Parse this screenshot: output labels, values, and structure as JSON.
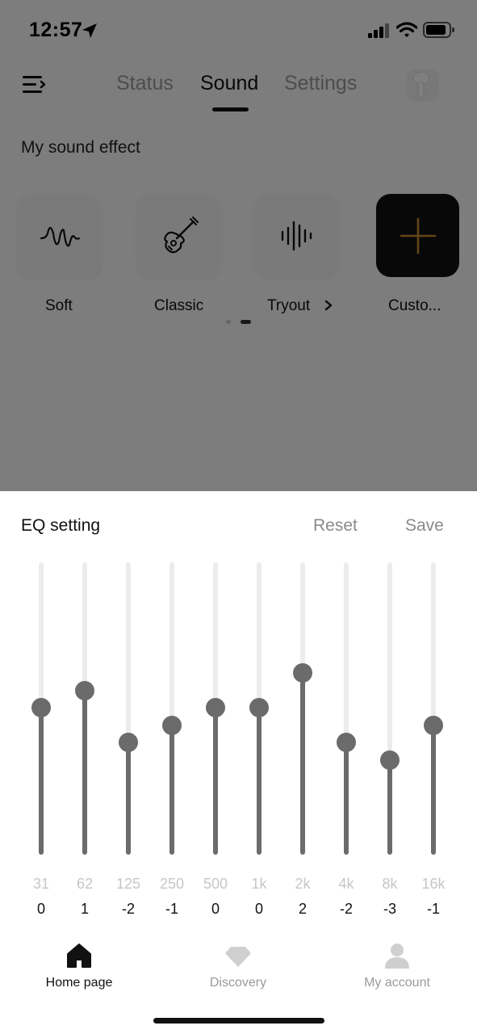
{
  "status_bar": {
    "time": "12:57"
  },
  "header": {
    "tabs": [
      {
        "label": "Status"
      },
      {
        "label": "Sound",
        "active": true
      },
      {
        "label": "Settings"
      }
    ]
  },
  "sound_effects": {
    "title": "My sound effect",
    "items": [
      {
        "label": "Soft",
        "icon": "sound-wave-icon"
      },
      {
        "label": "Classic",
        "icon": "guitar-icon"
      },
      {
        "label": "Tryout",
        "icon": "audio-bars-icon"
      },
      {
        "label": "Custo...",
        "icon": "plus-icon"
      }
    ],
    "page_indicator": {
      "count": 2,
      "active": 2
    }
  },
  "eq": {
    "title": "EQ setting",
    "reset_label": "Reset",
    "save_label": "Save",
    "gain_range": [
      -8,
      8
    ],
    "bands": [
      {
        "freq": "31",
        "gain": "0",
        "value": 0
      },
      {
        "freq": "62",
        "gain": "1",
        "value": 1
      },
      {
        "freq": "125",
        "gain": "-2",
        "value": -2
      },
      {
        "freq": "250",
        "gain": "-1",
        "value": -1
      },
      {
        "freq": "500",
        "gain": "0",
        "value": 0
      },
      {
        "freq": "1k",
        "gain": "0",
        "value": 0
      },
      {
        "freq": "2k",
        "gain": "2",
        "value": 2
      },
      {
        "freq": "4k",
        "gain": "-2",
        "value": -2
      },
      {
        "freq": "8k",
        "gain": "-3",
        "value": -3
      },
      {
        "freq": "16k",
        "gain": "-1",
        "value": -1
      }
    ]
  },
  "bottom_nav": [
    {
      "label": "Home page",
      "icon": "home-icon",
      "active": true
    },
    {
      "label": "Discovery",
      "icon": "diamond-icon"
    },
    {
      "label": "My account",
      "icon": "user-icon"
    }
  ],
  "colors": {
    "accent_custom": "#c98a2e",
    "slider_fill": "#6b6b6b",
    "active_text": "#111111",
    "inactive_text": "#9a9a9a"
  }
}
